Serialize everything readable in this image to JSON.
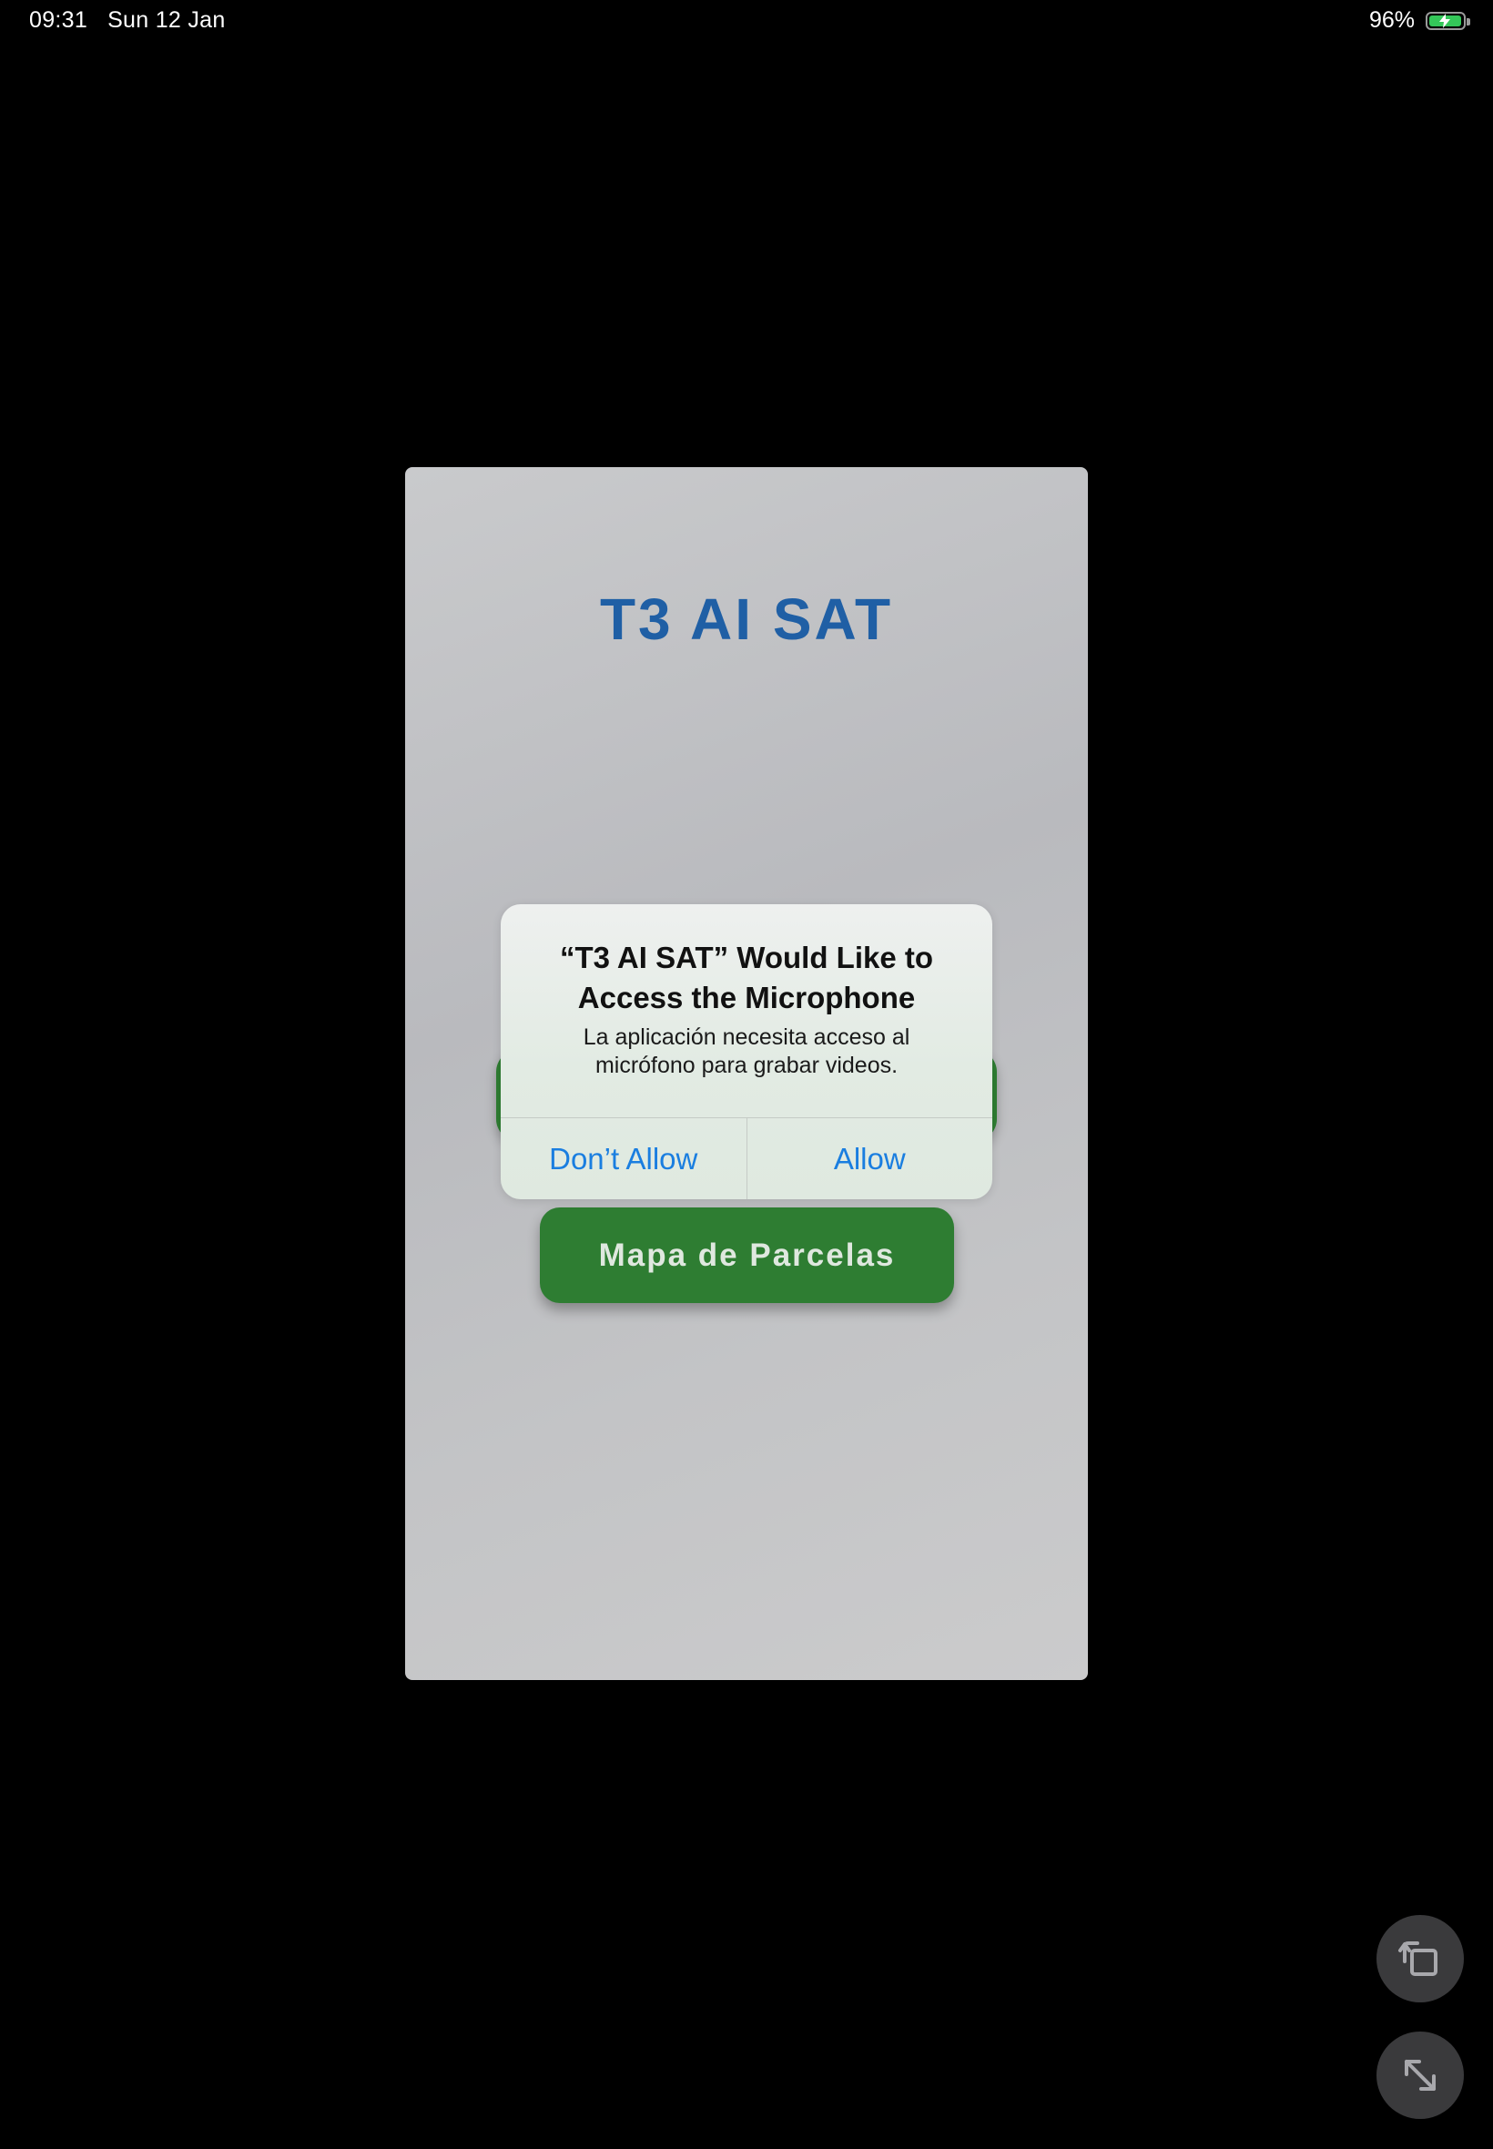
{
  "status_bar": {
    "time": "09:31",
    "date": "Sun 12 Jan",
    "battery_percent": "96%",
    "battery_icon": "battery-charging-icon",
    "battery_level": 0.96,
    "battery_color": "#34c759"
  },
  "app": {
    "title": "T3 AI SAT",
    "title_color": "#1f5fa5",
    "button_color": "#2e7d32",
    "map_button_label": "Mapa de Parcelas"
  },
  "alert": {
    "title": "“T3 AI SAT” Would Like to Access the Microphone",
    "message": "La aplicación necesita acceso al micrófono para grabar videos.",
    "deny_label": "Don’t Allow",
    "allow_label": "Allow",
    "button_color": "#1a7ee0"
  },
  "controls": {
    "rotate_icon": "rotate-screen-icon",
    "expand_icon": "expand-icon"
  }
}
